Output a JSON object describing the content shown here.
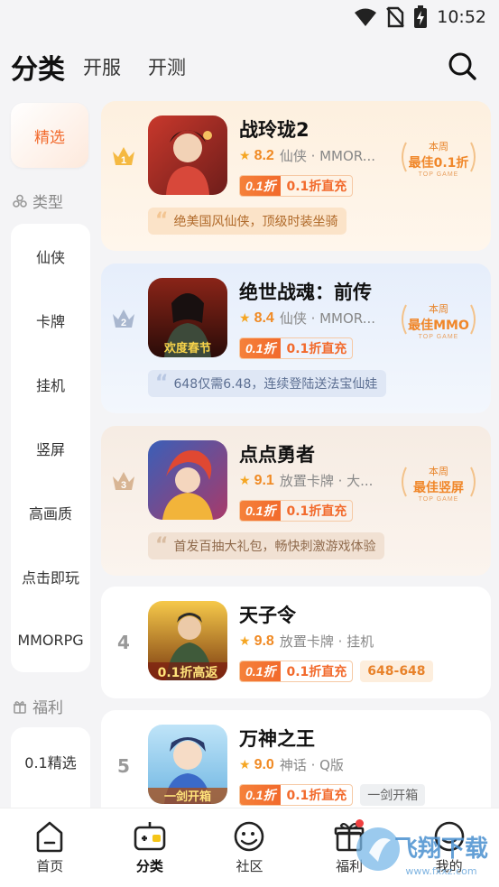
{
  "status_bar": {
    "time": "10:52"
  },
  "header": {
    "tab_active": "分类",
    "tab_2": "开服",
    "tab_3": "开测"
  },
  "sidebar": {
    "featured": "精选",
    "section_type": "类型",
    "types": [
      "仙侠",
      "卡牌",
      "挂机",
      "竖屏",
      "高画质",
      "点击即玩",
      "MMORPG"
    ],
    "section_welfare": "福利",
    "welfare": [
      "0.1精选"
    ]
  },
  "games": [
    {
      "rank": "1",
      "title": "战玲珑2",
      "score": "8.2",
      "tags": "仙侠 · MMOR...",
      "disc_a": "0.1折",
      "disc_b": "0.1折直充",
      "quote": "绝美国风仙侠，顶级时装坐骑",
      "award_top": "本周",
      "award_main": "最佳0.1折",
      "award_sub": "TOP GAME"
    },
    {
      "rank": "2",
      "title": "绝世战魂：前传",
      "score": "8.4",
      "tags": "仙侠 · MMOR...",
      "disc_a": "0.1折",
      "disc_b": "0.1折直充",
      "quote": "648仅需6.48，连续登陆送法宝仙娃",
      "award_top": "本周",
      "award_main": "最佳MMO",
      "award_sub": "TOP GAME",
      "icon_text": "欢度春节"
    },
    {
      "rank": "3",
      "title": "点点勇者",
      "score": "9.1",
      "tags": "放置卡牌 · 大...",
      "disc_a": "0.1折",
      "disc_b": "0.1折直充",
      "quote": "首发百抽大礼包，畅快刺激游戏体验",
      "award_top": "本周",
      "award_main": "最佳竖屏",
      "award_sub": "TOP GAME"
    },
    {
      "rank": "4",
      "title": "天子令",
      "score": "9.8",
      "tags": "放置卡牌 · 挂机",
      "disc_a": "0.1折",
      "disc_b": "0.1折直充",
      "extra": "648-648",
      "icon_text": "0.1折高返"
    },
    {
      "rank": "5",
      "title": "万神之王",
      "score": "9.0",
      "tags": "神话 · Q版",
      "disc_a": "0.1折",
      "disc_b": "0.1折直充",
      "extra": "一剑开箱",
      "icon_text": "一剑开箱"
    }
  ],
  "bottom_nav": [
    "首页",
    "分类",
    "社区",
    "福利",
    "我的"
  ],
  "watermark": {
    "text": "飞翔下载",
    "url": "www.fxxz.com"
  },
  "colors": {
    "accent": "#f26a2c",
    "score": "#f08a24"
  }
}
